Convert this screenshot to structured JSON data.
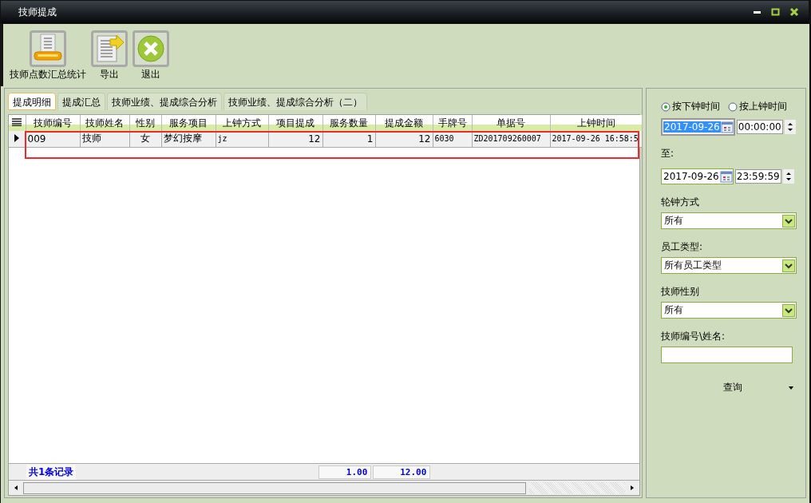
{
  "window": {
    "title": "技师提成"
  },
  "toolbar": [
    {
      "kind": "stats",
      "label": "技师点数汇总统计"
    },
    {
      "kind": "export",
      "label": "导出"
    },
    {
      "kind": "exit",
      "label": "退出"
    }
  ],
  "tabs": [
    {
      "label": "提成明细",
      "selected": true
    },
    {
      "label": "提成汇总",
      "selected": false
    },
    {
      "label": "技师业绩、提成综合分析",
      "selected": false
    },
    {
      "label": "技师业绩、提成综合分析（二）",
      "selected": false
    }
  ],
  "table": {
    "columns": [
      "技师编号",
      "技师姓名",
      "性别",
      "服务项目",
      "上钟方式",
      "项目提成",
      "服务数量",
      "提成金额",
      "手牌号",
      "单据号",
      "上钟时间"
    ],
    "rows": [
      {
        "selected": true,
        "cells": [
          "009",
          "技师",
          "女",
          "梦幻按摩",
          "jz",
          "12",
          "1",
          "12",
          "6030",
          "ZD201709260007",
          "2017-09-26 16:58:5"
        ]
      }
    ],
    "footer": {
      "record_count": "共1条记录",
      "quantity_total": "1.00",
      "amount_total": "12.00"
    }
  },
  "filters": {
    "time_basis": [
      {
        "label": "按下钟时间",
        "selected": true
      },
      {
        "label": "按上钟时间",
        "selected": false
      }
    ],
    "from": {
      "date": "2017-09-26",
      "focused": true,
      "time": "00:00:00"
    },
    "to_label": "至:",
    "to": {
      "date": "2017-09-26",
      "focused": false,
      "time": "23:59:59"
    },
    "dropdowns": [
      {
        "label": "轮钟方式",
        "value": "所有"
      },
      {
        "label": "员工类型:",
        "value": "所有员工类型"
      },
      {
        "label": "技师性别",
        "value": "所有"
      }
    ],
    "search": {
      "label": "技师编号\\姓名:"
    },
    "query_button": "查询"
  }
}
